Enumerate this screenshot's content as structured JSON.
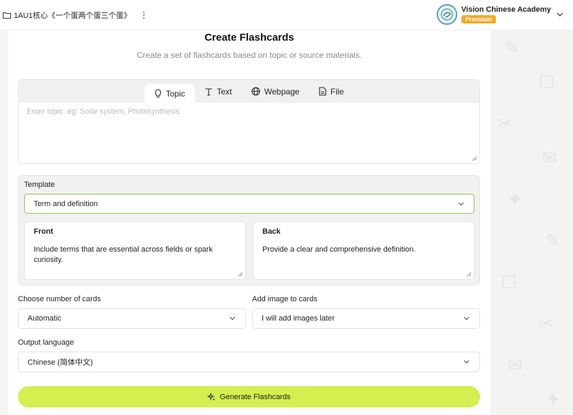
{
  "header": {
    "doc_title": "1AU1核心《一个蛋两个蛋三个蛋》",
    "menu_glyph": "⋮",
    "org_name": "Vision Chinese Academy",
    "org_badge": "Premium"
  },
  "page": {
    "title": "Create Flashcards",
    "subtitle": "Create a set of flashcards based on topic or source materials."
  },
  "source": {
    "tabs": [
      {
        "label": "Topic",
        "icon": "lightbulb-icon",
        "active": true
      },
      {
        "label": "Text",
        "icon": "text-icon",
        "active": false
      },
      {
        "label": "Webpage",
        "icon": "globe-icon",
        "active": false
      },
      {
        "label": "File",
        "icon": "file-icon",
        "active": false
      }
    ],
    "placeholder": "Enter topic. eg: Solar system, Photosynthesis",
    "value": ""
  },
  "template": {
    "label": "Template",
    "selected": "Term and definition",
    "front": {
      "title": "Front",
      "text": "Include terms that are essential across fields or spark curiosity."
    },
    "back": {
      "title": "Back",
      "text": "Provide a clear and comprehensive definition."
    }
  },
  "options": {
    "cards_label": "Choose number of cards",
    "cards_value": "Automatic",
    "image_label": "Add image to cards",
    "image_value": "I will add images later",
    "language_label": "Output language",
    "language_value": "Chinese (简体中文)"
  },
  "action": {
    "generate_label": "Generate Flashcards"
  },
  "colors": {
    "accent": "#d4ef50",
    "focus_border": "#8bc34a",
    "badge": "#f0a922"
  }
}
